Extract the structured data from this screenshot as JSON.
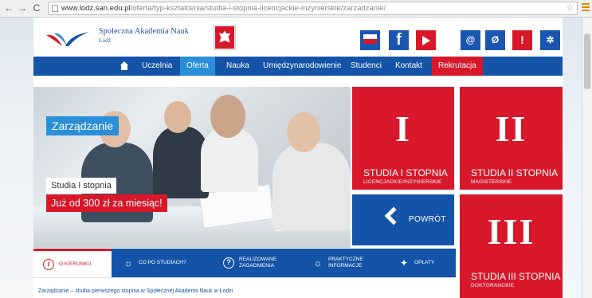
{
  "browser": {
    "url_host": "www.lodz.san.edu.pl",
    "url_path": "/oferta/typ-ksztalcenia/studia-i-stopnia-licencjackie-inzynierskie/zarzadzanie/"
  },
  "header": {
    "logo_line1": "Społeczna Akademia Nauk",
    "logo_line2": "Łódź",
    "icons": [
      "flag-pl-icon",
      "facebook-icon",
      "youtube-icon",
      "email-icon",
      "card-icon",
      "alert-icon",
      "gear-icon"
    ],
    "facebook_glyph": "f",
    "email_glyph": "@",
    "card_glyph": "Ø",
    "alert_glyph": "!",
    "gear_glyph": "✲"
  },
  "nav": {
    "items": [
      "Uczelnia",
      "Oferta",
      "Nauka",
      "Umiędzynarodowienie",
      "Studenci",
      "Kontakt",
      "Rekrutacja"
    ],
    "active": "Oferta"
  },
  "hero": {
    "tag": "Zarządzanie",
    "subtitle": "Studia I stopnia",
    "price": "Już od 300 zł za miesiąc!"
  },
  "tiles": {
    "one": {
      "roman": "I",
      "title": "STUDIA I STOPNIA",
      "sub": "LICENCJACKIE/INŻYNIERSKIE"
    },
    "two": {
      "roman": "II",
      "title": "STUDIA II STOPNIA",
      "sub": "MAGISTERSKIE"
    },
    "back": {
      "label": "POWRÓT"
    },
    "three": {
      "roman": "III",
      "title": "STUDIA III STOPNIA",
      "sub": "DOKTORANCKIE"
    }
  },
  "tabs": [
    {
      "label": "O KIERUNKU",
      "icon": "info-icon",
      "glyph": "i"
    },
    {
      "label": "CO PO STUDIACH?",
      "icon": "bulb-icon",
      "glyph": "☼"
    },
    {
      "label1": "REALIZOWANE",
      "label2": "ZAGADNIENIA",
      "icon": "question-icon",
      "glyph": "?"
    },
    {
      "label1": "PRAKTYCZNE",
      "label2": "INFORMACJE",
      "icon": "bulb-icon",
      "glyph": "☼"
    },
    {
      "label": "OPŁATY",
      "icon": "coins-icon",
      "glyph": "✦"
    }
  ],
  "content": {
    "breadcrumb": "Zarządzanie – studia pierwszego stopnia w Społecznej Akademii Nauk w Łodzi"
  },
  "colors": {
    "red": "#d8182a",
    "blue": "#1454a8",
    "light_blue": "#2a8fd8"
  }
}
